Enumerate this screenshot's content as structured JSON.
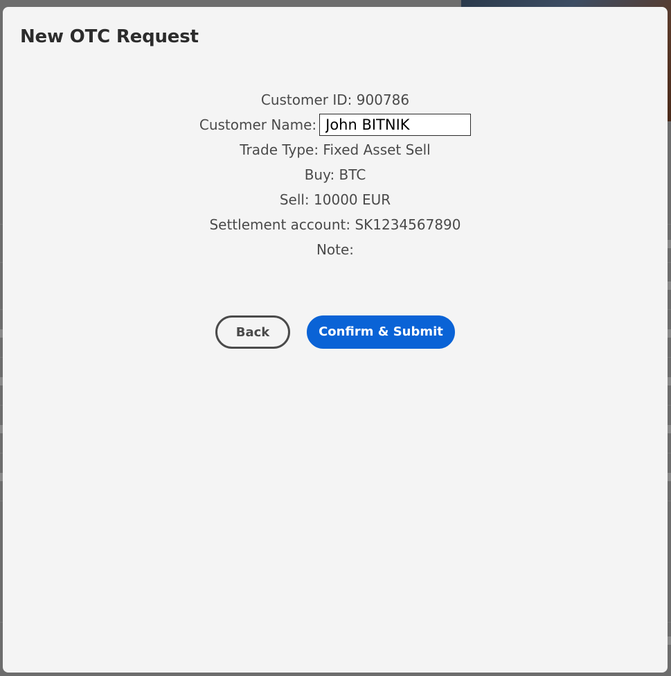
{
  "modal": {
    "title": "New OTC Request",
    "details": {
      "customer_id": "Customer ID: 900786",
      "customer_name_label": "Customer Name:",
      "customer_name_value": "John BITNIK",
      "trade_type": "Trade Type: Fixed Asset Sell",
      "buy": "Buy: BTC",
      "sell": "Sell: 10000 EUR",
      "settlement_account": "Settlement account: SK1234567890",
      "note": "Note:"
    },
    "buttons": {
      "back": "Back",
      "confirm": "Confirm & Submit"
    }
  },
  "colors": {
    "modal_background": "#f4f4f4",
    "primary": "#0a63d6",
    "text": "#4a4a4a",
    "backdrop": "#6d6d6d"
  }
}
